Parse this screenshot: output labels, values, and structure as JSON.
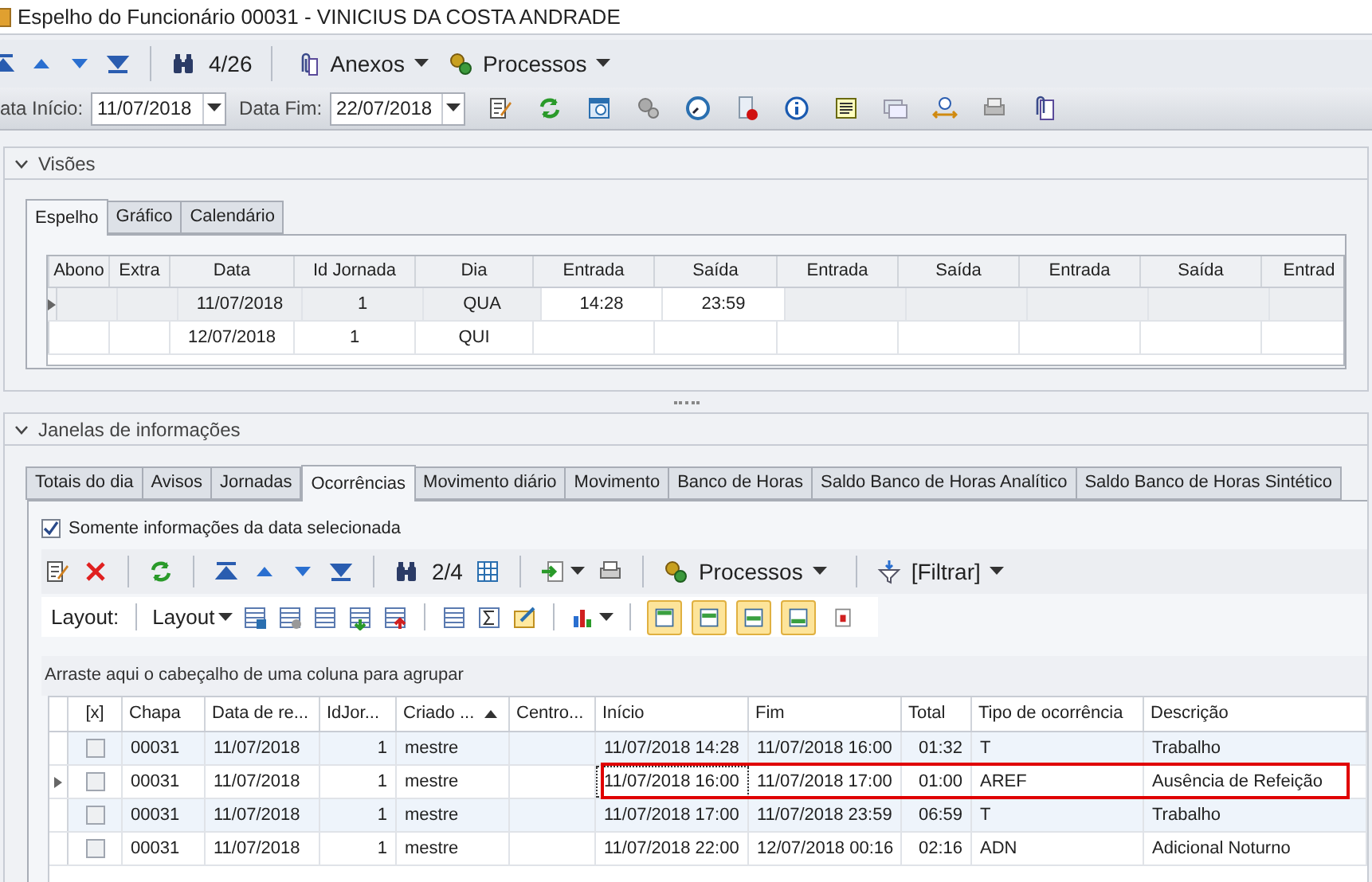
{
  "window": {
    "title": "Espelho do Funcionário 00031 - VINICIUS DA COSTA ANDRADE"
  },
  "toolbar": {
    "counter": "4/26",
    "menus": [
      "Anexos",
      "Processos"
    ]
  },
  "filters": [
    {
      "label": "ata Início:",
      "value": "11/07/2018"
    },
    {
      "label": "Data Fim:",
      "value": "22/07/2018"
    }
  ],
  "visoes": {
    "title": "Visões",
    "expanded": true,
    "tabs": [
      {
        "label": "Espelho",
        "selected": true
      },
      {
        "label": "Gráfico",
        "selected": false
      },
      {
        "label": "Calendário",
        "selected": false
      }
    ],
    "columns": [
      "Abono",
      "Extra",
      "Data",
      "Id Jornada",
      "Dia",
      "Entrada",
      "Saída",
      "Entrada",
      "Saída",
      "Entrada",
      "Saída",
      "Entrad"
    ],
    "rows": [
      {
        "current": true,
        "cells": [
          "",
          "",
          "11/07/2018",
          "1",
          "QUA",
          "14:28",
          "23:59",
          "",
          "",
          "",
          "",
          ""
        ]
      },
      {
        "current": false,
        "cells": [
          "",
          "",
          "12/07/2018",
          "1",
          "QUI",
          "",
          "",
          "",
          "",
          "",
          "",
          ""
        ]
      }
    ]
  },
  "janelas": {
    "title": "Janelas de informações",
    "expanded": true,
    "tabs": [
      {
        "label": "Totais do dia",
        "selected": false
      },
      {
        "label": "Avisos",
        "selected": false
      },
      {
        "label": "Jornadas",
        "selected": false
      },
      {
        "label": "Ocorrências",
        "selected": true
      },
      {
        "label": "Movimento diário",
        "selected": false
      },
      {
        "label": "Movimento",
        "selected": false
      },
      {
        "label": "Banco de Horas",
        "selected": false
      },
      {
        "label": "Saldo Banco de Horas Analítico",
        "selected": false
      },
      {
        "label": "Saldo Banco de Horas Sintético",
        "selected": false
      }
    ],
    "only_selected_date": {
      "label": "Somente informações da data selecionada",
      "checked": true
    },
    "toolbar": {
      "counter": "2/4",
      "menus": [
        "Processos",
        "[Filtrar]"
      ]
    },
    "layout_bar": {
      "label": "Layout:",
      "menu": "Layout",
      "toggles": [
        {
          "on": true
        },
        {
          "on": true
        },
        {
          "on": true
        },
        {
          "on": true
        },
        {
          "on": false
        }
      ]
    },
    "group_hint": "Arraste aqui o cabeçalho de uma coluna para agrupar",
    "columns": [
      {
        "label": "[x]",
        "sorted": false
      },
      {
        "label": "Chapa",
        "sorted": false
      },
      {
        "label": "Data de re...",
        "sorted": false
      },
      {
        "label": "IdJor...",
        "sorted": false
      },
      {
        "label": "Criado ...",
        "sorted": true
      },
      {
        "label": "Centro...",
        "sorted": false
      },
      {
        "label": "Início",
        "sorted": false
      },
      {
        "label": "Fim",
        "sorted": false
      },
      {
        "label": "Total",
        "sorted": false
      },
      {
        "label": "Tipo de ocorrência",
        "sorted": false
      },
      {
        "label": "Descrição",
        "sorted": false
      }
    ],
    "rows": [
      {
        "checked": false,
        "current": false,
        "highlighted": false,
        "cells": [
          "",
          "00031",
          "11/07/2018",
          "1",
          "mestre",
          "",
          "11/07/2018 14:28",
          "11/07/2018 16:00",
          "01:32",
          "T",
          "Trabalho"
        ]
      },
      {
        "checked": false,
        "current": true,
        "highlighted": true,
        "cells": [
          "",
          "00031",
          "11/07/2018",
          "1",
          "mestre",
          "",
          "11/07/2018 16:00",
          "11/07/2018 17:00",
          "01:00",
          "AREF",
          "Ausência de Refeição"
        ]
      },
      {
        "checked": false,
        "current": false,
        "highlighted": false,
        "cells": [
          "",
          "00031",
          "11/07/2018",
          "1",
          "mestre",
          "",
          "11/07/2018 17:00",
          "11/07/2018 23:59",
          "06:59",
          "T",
          "Trabalho"
        ]
      },
      {
        "checked": false,
        "current": false,
        "highlighted": false,
        "cells": [
          "",
          "00031",
          "11/07/2018",
          "1",
          "mestre",
          "",
          "11/07/2018 22:00",
          "12/07/2018 00:16",
          "02:16",
          "ADN",
          "Adicional Noturno"
        ]
      }
    ]
  }
}
